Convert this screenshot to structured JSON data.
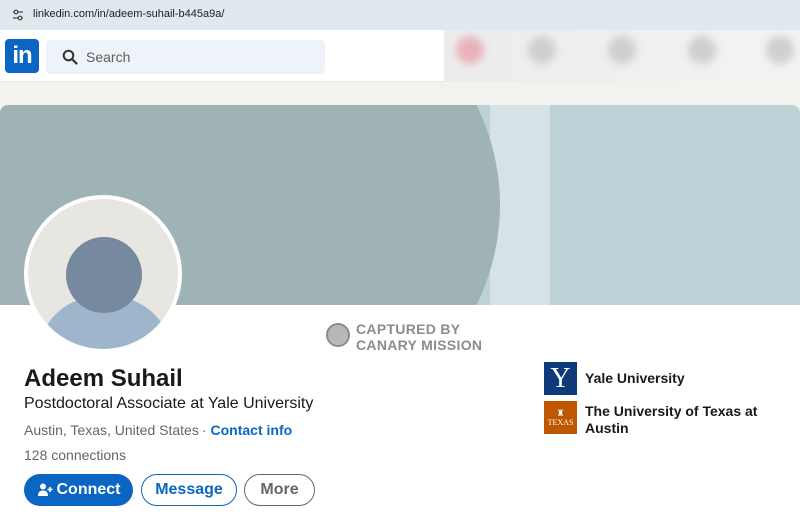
{
  "browser": {
    "url": "linkedin.com/in/adeem-suhail-b445a9a/"
  },
  "header": {
    "logo_text": "in",
    "search_placeholder": "Search"
  },
  "watermark": {
    "line1": "CAPTURED BY",
    "line2": "CANARY MISSION"
  },
  "profile": {
    "name": "Adeem Suhail",
    "headline": "Postdoctoral Associate at Yale University",
    "location": "Austin, Texas, United States",
    "separator": "·",
    "contact_info": "Contact info",
    "connections": "128 connections"
  },
  "actions": {
    "connect": "Connect",
    "message": "Message",
    "more": "More"
  },
  "organizations": [
    {
      "name": "Yale University",
      "logo_letter": "Y",
      "logo_color": "#0f3a7a"
    },
    {
      "name": "The University of Texas at Austin",
      "logo_text": "TEXAS",
      "logo_color": "#bf5700"
    }
  ],
  "colors": {
    "brand": "#0a66c2",
    "banner": "#bdd2d6"
  }
}
